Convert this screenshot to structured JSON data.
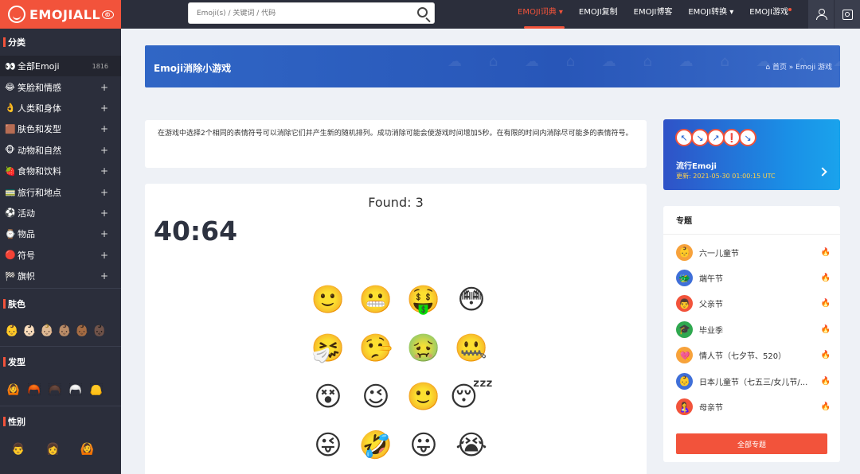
{
  "header": {
    "logo_text": "EMOJIALL",
    "logo_mark": "©",
    "search_placeholder": "Emoji(s) / 关键词 / 代码",
    "nav": [
      {
        "label": "EMOJI词典",
        "active": true
      },
      {
        "label": "EMOJI复制"
      },
      {
        "label": "EMOJI博客"
      },
      {
        "label": "EMOJI转换"
      },
      {
        "label": "EMOJI游戏"
      }
    ],
    "icons": [
      "user-icon",
      "image-icon"
    ]
  },
  "sidebar": {
    "categories_title": "分类",
    "categories": [
      {
        "icon": "👀",
        "label": "全部Emoji",
        "count": "1816"
      },
      {
        "icon": "😂",
        "label": "笑脸和情感"
      },
      {
        "icon": "👌",
        "label": "人类和身体"
      },
      {
        "icon": "🟫",
        "label": "肤色和发型"
      },
      {
        "icon": "🐵",
        "label": "动物和自然"
      },
      {
        "icon": "🍓",
        "label": "食物和饮料"
      },
      {
        "icon": "🚃",
        "label": "旅行和地点"
      },
      {
        "icon": "⚽",
        "label": "活动"
      },
      {
        "icon": "⌚",
        "label": "物品"
      },
      {
        "icon": "🔴",
        "label": "符号"
      },
      {
        "icon": "🏁",
        "label": "旗帜"
      }
    ],
    "skin_title": "肤色",
    "skin_tones": [
      "👶",
      "👶🏻",
      "👶🏼",
      "👶🏽",
      "👶🏾",
      "👶🏿"
    ],
    "hair_title": "发型",
    "hair_styles": [
      "🙆",
      "🦰",
      "🦱",
      "🦳",
      "🦲"
    ],
    "gender_title": "性别",
    "genders": [
      "👨",
      "👩",
      "🙆"
    ]
  },
  "banner": {
    "title": "Emoji消除小游戏",
    "breadcrumb": "⌂ 首页 » Emoji 游戏"
  },
  "description": "在游戏中选择2个相同的表情符号可以消除它们并产生新的随机排列。成功消除可能会使游戏时间增加5秒。在有限的时间内消除尽可能多的表情符号。",
  "game": {
    "found_label": "Found: 3",
    "timer": "40:64",
    "emojis": [
      "🙂",
      "😬",
      "🤑",
      "😳",
      "🤧",
      "🤥",
      "🤢",
      "🤐",
      "😵",
      "😉",
      "🙂",
      "😴",
      "😜",
      "🤣",
      "😛",
      "😭"
    ]
  },
  "trending": {
    "icons": [
      "↖",
      "↘",
      "↗",
      "❗",
      "↘"
    ],
    "title": "流行Emoji",
    "updated": "更新: 2021-05-30 01:00:15 UTC"
  },
  "topics": {
    "title": "专题",
    "items": [
      {
        "icon": "👶",
        "label": "六一儿童节",
        "color": "#f7a23b"
      },
      {
        "icon": "🐲",
        "label": "端午节",
        "color": "#3f6fd8"
      },
      {
        "icon": "👨",
        "label": "父亲节",
        "color": "#f2533b"
      },
      {
        "icon": "🎓",
        "label": "毕业季",
        "color": "#2fa84f"
      },
      {
        "icon": "💘",
        "label": "情人节（七夕节、520）",
        "color": "#f7a23b"
      },
      {
        "icon": "👶",
        "label": "日本儿童节（七五三/女儿节/...",
        "color": "#3f6fd8"
      },
      {
        "icon": "🤱",
        "label": "母亲节",
        "color": "#f2533b"
      }
    ],
    "all_button": "全部专题"
  },
  "colors": {
    "accent": "#f2533b",
    "dark": "#2b2e3b",
    "banner_blue": "#2856b8"
  }
}
